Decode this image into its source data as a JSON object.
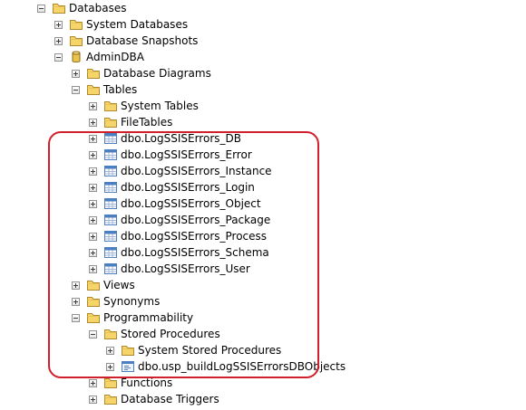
{
  "tree": {
    "nodes": [
      {
        "label": "Databases",
        "icon": "folder-icon",
        "state": "expanded",
        "level": 0
      },
      {
        "label": "System Databases",
        "icon": "folder-icon",
        "state": "collapsed",
        "level": 1
      },
      {
        "label": "Database Snapshots",
        "icon": "folder-icon",
        "state": "collapsed",
        "level": 1
      },
      {
        "label": "AdminDBA",
        "icon": "database-icon",
        "state": "expanded",
        "level": 1
      },
      {
        "label": "Database Diagrams",
        "icon": "folder-icon",
        "state": "collapsed",
        "level": 2
      },
      {
        "label": "Tables",
        "icon": "folder-icon",
        "state": "expanded",
        "level": 2
      },
      {
        "label": "System Tables",
        "icon": "folder-icon",
        "state": "collapsed",
        "level": 3
      },
      {
        "label": "FileTables",
        "icon": "folder-icon",
        "state": "collapsed",
        "level": 3
      },
      {
        "label": "dbo.LogSSISErrors_DB",
        "icon": "table-icon",
        "state": "collapsed",
        "level": 3
      },
      {
        "label": "dbo.LogSSISErrors_Error",
        "icon": "table-icon",
        "state": "collapsed",
        "level": 3
      },
      {
        "label": "dbo.LogSSISErrors_Instance",
        "icon": "table-icon",
        "state": "collapsed",
        "level": 3
      },
      {
        "label": "dbo.LogSSISErrors_Login",
        "icon": "table-icon",
        "state": "collapsed",
        "level": 3
      },
      {
        "label": "dbo.LogSSISErrors_Object",
        "icon": "table-icon",
        "state": "collapsed",
        "level": 3
      },
      {
        "label": "dbo.LogSSISErrors_Package",
        "icon": "table-icon",
        "state": "collapsed",
        "level": 3
      },
      {
        "label": "dbo.LogSSISErrors_Process",
        "icon": "table-icon",
        "state": "collapsed",
        "level": 3
      },
      {
        "label": "dbo.LogSSISErrors_Schema",
        "icon": "table-icon",
        "state": "collapsed",
        "level": 3
      },
      {
        "label": "dbo.LogSSISErrors_User",
        "icon": "table-icon",
        "state": "collapsed",
        "level": 3
      },
      {
        "label": "Views",
        "icon": "folder-icon",
        "state": "collapsed",
        "level": 2
      },
      {
        "label": "Synonyms",
        "icon": "folder-icon",
        "state": "collapsed",
        "level": 2
      },
      {
        "label": "Programmability",
        "icon": "folder-icon",
        "state": "expanded",
        "level": 2
      },
      {
        "label": "Stored Procedures",
        "icon": "folder-icon",
        "state": "expanded",
        "level": 3
      },
      {
        "label": "System Stored Procedures",
        "icon": "folder-icon",
        "state": "collapsed",
        "level": 4
      },
      {
        "label": "dbo.usp_buildLogSSISErrorsDBObjects",
        "icon": "stored-procedure-icon",
        "state": "collapsed",
        "level": 4
      },
      {
        "label": "Functions",
        "icon": "folder-icon",
        "state": "collapsed",
        "level": 3
      },
      {
        "label": "Database Triggers",
        "icon": "folder-icon",
        "state": "collapsed",
        "level": 3
      }
    ]
  },
  "colors": {
    "highlight_border": "#d11f2b",
    "folder_fill": "#f5d56a",
    "folder_stroke": "#b08a2a",
    "database_fill": "#e9c34b",
    "table_header": "#4a7fc1",
    "table_grid": "#9fb6d8"
  }
}
